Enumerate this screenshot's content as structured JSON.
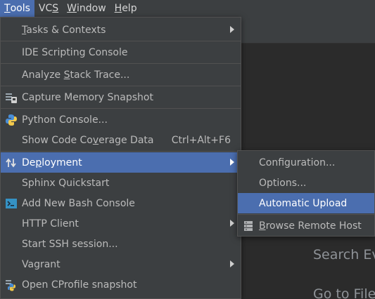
{
  "menubar": {
    "items": [
      {
        "label": "Tools",
        "mnemonic": "T",
        "rest": "ools"
      },
      {
        "label": "VCS",
        "mnemonic": "S",
        "pre": "VC"
      },
      {
        "label": "Window",
        "mnemonic": "W",
        "rest": "indow"
      },
      {
        "label": "Help",
        "mnemonic": "H",
        "rest": "elp"
      }
    ]
  },
  "tools_menu": {
    "tasks": {
      "pre": "",
      "mn": "T",
      "post": "asks & Contexts"
    },
    "ide_scripting": "IDE Scripting Console",
    "analyze": {
      "pre": "Analyze ",
      "mn": "S",
      "post": "tack Trace..."
    },
    "capture_memory": "Capture Memory Snapshot",
    "python_console": "Python Console...",
    "coverage": {
      "pre": "Show Code Co",
      "mn": "v",
      "post": "erage Data"
    },
    "coverage_shortcut": "Ctrl+Alt+F6",
    "deployment": {
      "pre": "De",
      "mn": "p",
      "post": "loyment"
    },
    "sphinx": "Sphinx Quickstart",
    "bash": "Add New Bash Console",
    "http_client": "HTTP Client",
    "ssh": "Start SSH session...",
    "vagrant": "Vagrant",
    "cprofile": "Open CProfile snapshot"
  },
  "deployment_menu": {
    "configuration": "Configuration...",
    "options": "Options...",
    "automatic_upload": "Automatic Upload",
    "browse_remote": {
      "pre": "",
      "mn": "B",
      "post": "rowse Remote Host"
    }
  },
  "editor_hints": {
    "search": "Search Ev",
    "goto": "Go to File"
  },
  "colors": {
    "menu_bg": "#3c3f41",
    "selection": "#4b6eaf",
    "editor_bg": "#2b2b2b"
  }
}
